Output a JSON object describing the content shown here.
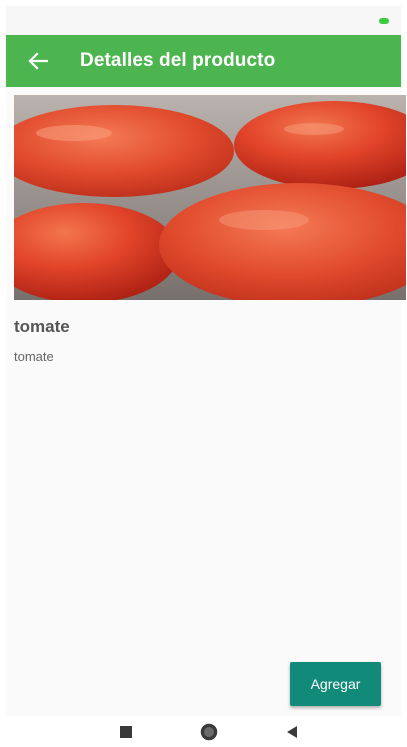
{
  "app_bar": {
    "title": "Detalles del producto",
    "back_icon": "arrow-back-icon",
    "color": "#4cb54f"
  },
  "product": {
    "name": "tomate",
    "description": "tomate",
    "image_subject": "tomatoes-photo"
  },
  "actions": {
    "add_label": "Agregar",
    "add_color": "#128a7a"
  },
  "nav_bar": {
    "icons": [
      "recents-square-icon",
      "home-circle-icon",
      "back-triangle-icon"
    ]
  }
}
